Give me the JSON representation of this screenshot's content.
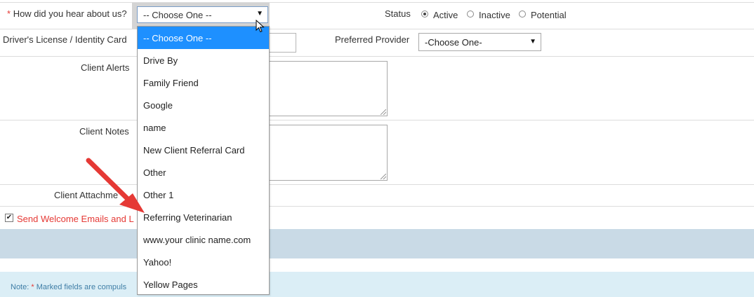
{
  "form": {
    "how_heard": {
      "required_mark": "*",
      "label": "How did you hear about us?",
      "selected": "-- Choose One --",
      "caret": "▼"
    },
    "status": {
      "label": "Status",
      "options": [
        "Active",
        "Inactive",
        "Potential"
      ],
      "selected": "Active"
    },
    "license_label": "Driver's License / Identity Card",
    "preferred_provider": {
      "label": "Preferred Provider",
      "selected": "-Choose One-",
      "caret": "▼"
    },
    "client_alerts_label": "Client Alerts",
    "client_notes_label": "Client Notes",
    "client_attachments_label": "Client Attachme",
    "welcome_checkbox": {
      "checked": true,
      "mark": "✔",
      "label": "Send Welcome Emails and L"
    },
    "note": {
      "prefix": "Note: ",
      "required_mark": "*",
      "text": " Marked fields are compuls"
    }
  },
  "dropdown": {
    "options": [
      "-- Choose One --",
      "Drive By",
      "Family Friend",
      "Google",
      "name",
      "New Client Referral Card",
      "Other",
      "Other 1",
      "Referring Veterinarian",
      "www.your clinic name.com",
      "Yahoo!",
      "Yellow Pages"
    ],
    "highlighted_index": 0
  },
  "annotation": {
    "arrow_color": "#e53935",
    "points_to": "Referring Veterinarian"
  },
  "colors": {
    "required": "#e53935",
    "selection": "#1e90ff",
    "band_blue": "#c9dae6",
    "band_note": "#dbeef6",
    "note_text": "#3f7ea6"
  }
}
